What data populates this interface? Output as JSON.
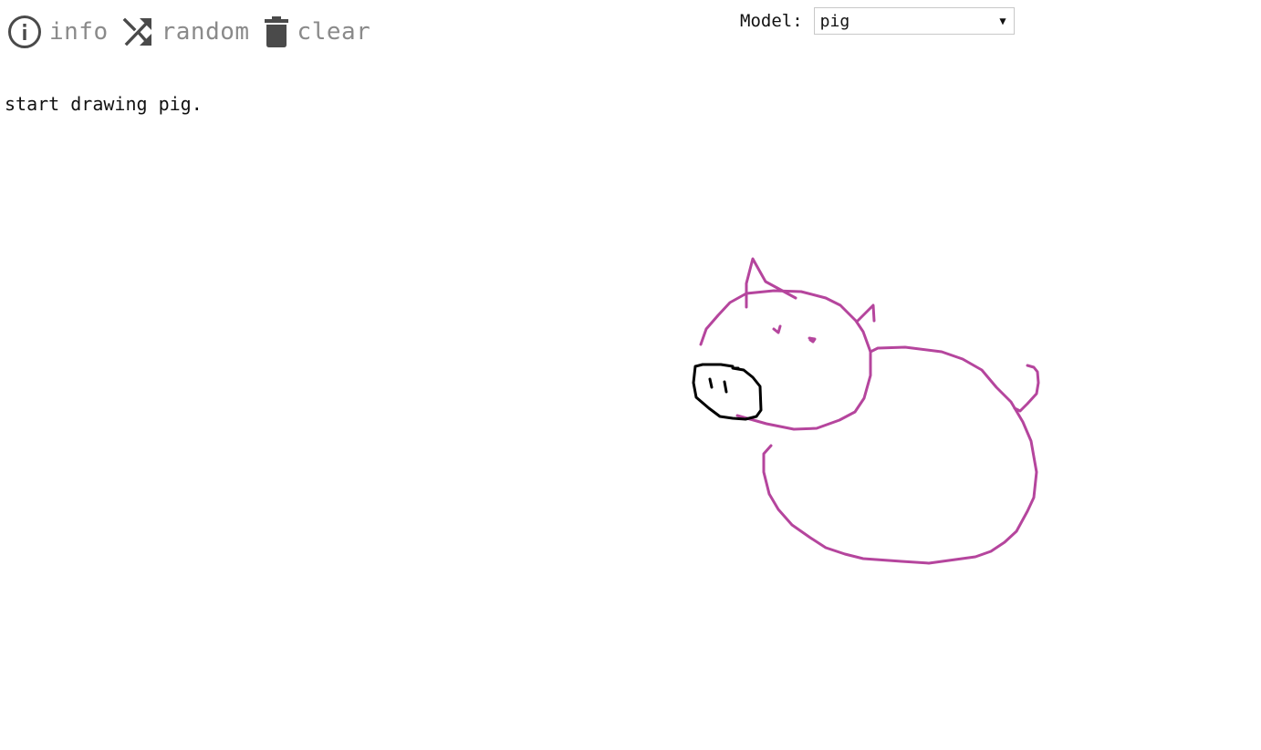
{
  "toolbar": {
    "info_label": "info",
    "random_label": "random",
    "clear_label": "clear"
  },
  "model": {
    "label": "Model:",
    "selected": "pig"
  },
  "status": "start drawing pig.",
  "colors": {
    "generated_stroke": "#b5459d",
    "user_stroke": "#000000",
    "toolbar_icon": "#4a4a4a",
    "toolbar_text": "#8a8a8a"
  },
  "icons": [
    "info-icon",
    "shuffle-icon",
    "trash-icon",
    "chevron-down-icon"
  ]
}
